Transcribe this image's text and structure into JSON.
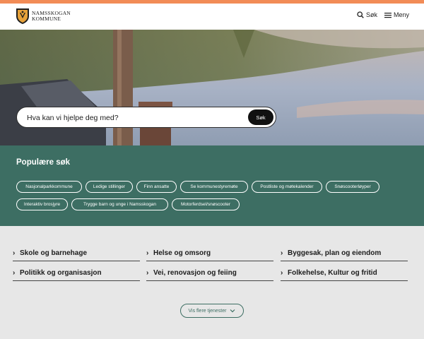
{
  "header": {
    "logo_line1": "NAMSSKOGAN",
    "logo_line2": "KOMMUNE",
    "search_label": "Søk",
    "menu_label": "Meny"
  },
  "hero": {
    "search_placeholder": "Hva kan vi hjelpe deg med?",
    "search_button": "Søk"
  },
  "popular": {
    "title": "Populære søk",
    "chips": [
      "Nasjonalparkkommune",
      "Ledige stillinger",
      "Finn ansatte",
      "Se kommunestyremøte",
      "Postliste og møtekalender",
      "Snøscooterløyper",
      "Interaktiv brosjyre",
      "Trygge barn og unge i Namsskogan",
      "Motorferdsel/snøscooter"
    ]
  },
  "services": {
    "items": [
      "Skole og barnehage",
      "Helse og omsorg",
      "Byggesak, plan og eiendom",
      "Politikk og organisasjon",
      "Vei, renovasjon og feiing",
      "Folkehelse, Kultur og fritid"
    ],
    "more_label": "Vis flere tjenester"
  },
  "colors": {
    "accent_bar": "#f28c57",
    "green": "#3d6e63",
    "background": "#e7e7e7"
  }
}
